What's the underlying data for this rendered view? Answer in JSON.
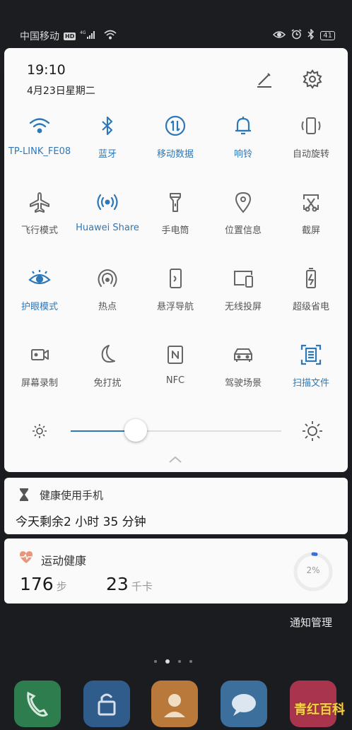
{
  "status_bar": {
    "carrier": "中国移动",
    "hd": "HD",
    "network": "4G",
    "battery": "41"
  },
  "panel": {
    "time": "19:10",
    "date": "4月23日星期二",
    "tiles": [
      {
        "label": "TP-LINK_FE08",
        "icon": "wifi-icon",
        "on": true
      },
      {
        "label": "蓝牙",
        "icon": "bluetooth-icon",
        "on": true
      },
      {
        "label": "移动数据",
        "icon": "mobile-data-icon",
        "on": true
      },
      {
        "label": "响铃",
        "icon": "bell-icon",
        "on": true
      },
      {
        "label": "自动旋转",
        "icon": "rotate-icon",
        "on": false
      },
      {
        "label": "飞行模式",
        "icon": "airplane-icon",
        "on": false
      },
      {
        "label": "Huawei Share",
        "icon": "huawei-share-icon",
        "on": true
      },
      {
        "label": "手电筒",
        "icon": "flashlight-icon",
        "on": false
      },
      {
        "label": "位置信息",
        "icon": "location-icon",
        "on": false
      },
      {
        "label": "截屏",
        "icon": "screenshot-icon",
        "on": false
      },
      {
        "label": "护眼模式",
        "icon": "eye-icon",
        "on": true
      },
      {
        "label": "热点",
        "icon": "hotspot-icon",
        "on": false
      },
      {
        "label": "悬浮导航",
        "icon": "floating-nav-icon",
        "on": false
      },
      {
        "label": "无线投屏",
        "icon": "cast-icon",
        "on": false
      },
      {
        "label": "超级省电",
        "icon": "battery-saver-icon",
        "on": false
      },
      {
        "label": "屏幕录制",
        "icon": "screen-record-icon",
        "on": false
      },
      {
        "label": "免打扰",
        "icon": "moon-icon",
        "on": false
      },
      {
        "label": "NFC",
        "icon": "nfc-icon",
        "on": false
      },
      {
        "label": "驾驶场景",
        "icon": "car-icon",
        "on": false
      },
      {
        "label": "扫描文件",
        "icon": "scan-document-icon",
        "on": true
      }
    ],
    "brightness_level": 0.31
  },
  "health_card": {
    "title": "健康使用手机",
    "body": "今天剩余2 小时 35 分钟"
  },
  "sport_card": {
    "title": "运动健康",
    "steps": "176",
    "steps_unit": "步",
    "calories": "23",
    "calories_unit": "千卡",
    "progress_label": "2%",
    "progress": 0.02
  },
  "notify_manage": "通知管理",
  "watermark": "青红百科",
  "colors": {
    "accent": "#2e78b8",
    "inactive": "#666666"
  }
}
